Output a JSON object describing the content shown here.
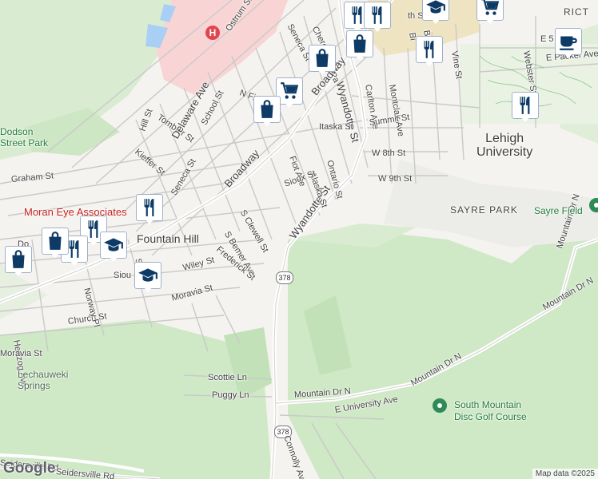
{
  "map": {
    "attribution": "Map data ©2025",
    "logo": "Google",
    "route_shield": "378",
    "neighborhoods": {
      "lehigh_university": "Lehigh\nUniversity",
      "fountain_hill": "Fountain Hill",
      "sayre_park": "SAYRE PARK",
      "district": "RICT"
    },
    "places": {
      "moran_eye": "Moran Eye Associates",
      "dodson_park": "Dodson\nStreet Park",
      "sayre_field": "Sayre Field",
      "lechauweki": "Lechauweki\nSprings",
      "disc_golf": "South Mountain\nDisc Golf Course"
    },
    "streets": {
      "ostrum": "Ostrum St",
      "seneca_top": "Seneca St",
      "cherokee": "Cherokee St",
      "tombler": "Tombler St",
      "hill": "Hill St",
      "delaware": "Delaware Ave",
      "school": "School St",
      "kieffer": "Kieffer St",
      "n_fiot": "N Fiot",
      "broadway_top": "Broadway",
      "broadway_mid": "Broadway",
      "graham": "Graham St",
      "seneca_mid": "Seneca St",
      "wyandotte_top": "Wyandotte St",
      "wyandotte_mid": "Wyandotte St",
      "carlton": "Carlton Ave",
      "montclair": "Montclair Ave",
      "itaska": "Itaska St",
      "summit": "Summit St",
      "w8th": "W 8th St",
      "w9th": "W 9th St",
      "ontario": "Ontario St",
      "alaska": "Alaska St",
      "fiot_ave": "Fiot Ave",
      "sioux": "Sioux St",
      "s_clewell": "S Clewell St",
      "s_bemer": "S Bemer Ave",
      "frederick": "Frederick St",
      "wiley": "Wiley St",
      "moravia_main": "Moravia St",
      "church": "Church St",
      "norway": "Norway Pl",
      "hertzog": "Hertzog Ave",
      "moravia_left": "Moravia St",
      "s_ly": "S Ly",
      "sioux_left": "Siou",
      "mountain_dr_n_1": "Mountain Dr N",
      "mountain_dr_n_2": "Mountain Dr N",
      "mountain_dr_n_3": "Mountain Dr N",
      "mountain_dr_n_4": "Mountain Dr N",
      "e_university": "E University Ave",
      "scottie": "Scottie Ln",
      "puggy": "Puggy Ln",
      "connolly": "Connolly Ave",
      "seidersville_1": "Seidersville Rd",
      "seidersville_2": "Seidersville Rd",
      "vine": "Vine St",
      "webster": "Webster St",
      "e5th": "E 5",
      "e_packer": "E Packer Ave",
      "pa": "Pa",
      "do": "Do",
      "bi": "Bi",
      "bro": "Bro",
      "ith": "th St"
    },
    "pins": [
      {
        "icon": "restaurant-icon"
      },
      {
        "icon": "restaurant-icon"
      },
      {
        "icon": "restaurant-icon"
      },
      {
        "icon": "graduation-cap-icon"
      },
      {
        "icon": "shopping-cart-icon"
      },
      {
        "icon": "coffee-cup-icon"
      },
      {
        "icon": "shopping-bag-icon"
      },
      {
        "icon": "shopping-bag-icon"
      },
      {
        "icon": "shopping-cart-icon"
      },
      {
        "icon": "shopping-bag-icon"
      },
      {
        "icon": "restaurant-icon"
      },
      {
        "icon": "restaurant-icon"
      },
      {
        "icon": "restaurant-icon"
      },
      {
        "icon": "restaurant-icon"
      },
      {
        "icon": "graduation-cap-icon"
      },
      {
        "icon": "shopping-bag-icon"
      },
      {
        "icon": "shopping-bag-icon"
      },
      {
        "icon": "graduation-cap-icon"
      }
    ],
    "colors": {
      "park_green": "#cfe8c5",
      "hospital_pink": "#fadada",
      "pin_blue": "#0d3b66",
      "campus_tan": "#ecdfb3"
    }
  }
}
